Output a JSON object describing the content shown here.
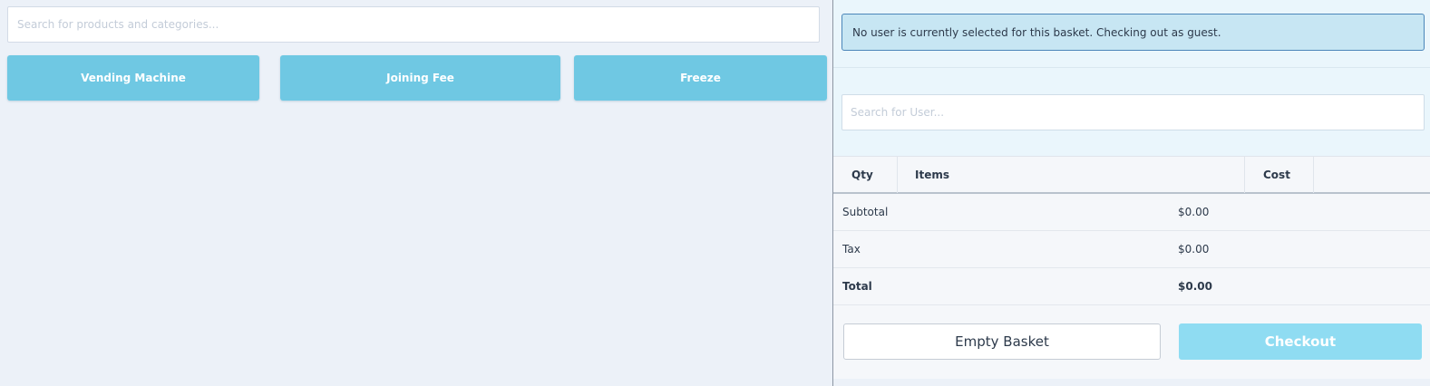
{
  "products": {
    "search_placeholder": "Search for products and categories...",
    "buttons": [
      {
        "label": "Vending Machine"
      },
      {
        "label": "Joining Fee"
      },
      {
        "label": "Freeze"
      }
    ],
    "button_color": "#6fc8e3"
  },
  "basket": {
    "alert_text": "No user is currently selected for this basket. Checking out as guest.",
    "user_search_placeholder": "Search for User...",
    "columns": {
      "qty": "Qty",
      "items": "Items",
      "cost": "Cost"
    },
    "totals": [
      {
        "label": "Subtotal",
        "value": "$0.00"
      },
      {
        "label": "Tax",
        "value": "$0.00"
      },
      {
        "label": "Total",
        "value": "$0.00"
      }
    ],
    "empty_label": "Empty Basket",
    "checkout_label": "Checkout"
  },
  "colors": {
    "background": "#ecf1f8",
    "alert_bg": "#c7e6f3",
    "alert_border": "#4b86b9",
    "checkout_bg": "#8fdcf2"
  }
}
